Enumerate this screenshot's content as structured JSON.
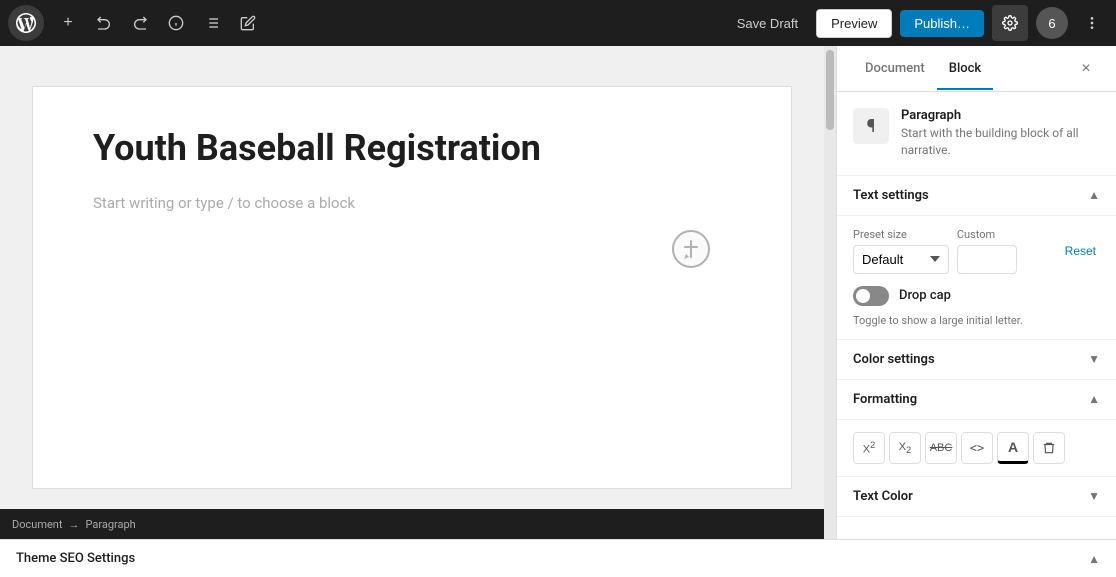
{
  "toolbar": {
    "logo_label": "WordPress",
    "add_btn": "+",
    "undo_btn": "↩",
    "redo_btn": "↪",
    "info_btn": "ℹ",
    "list_btn": "≡",
    "edit_btn": "✏",
    "save_draft_label": "Save Draft",
    "preview_label": "Preview",
    "publish_label": "Publish…",
    "settings_label": "⚙",
    "avatar_label": "6"
  },
  "editor": {
    "title": "Youth Baseball Registration",
    "placeholder": "Start writing or type / to choose a block",
    "footer": {
      "document_label": "Document",
      "arrow": "→",
      "paragraph_label": "Paragraph"
    }
  },
  "sidebar": {
    "tab_document": "Document",
    "tab_block": "Block",
    "close_icon": "×",
    "block_info": {
      "icon": "¶",
      "title": "Paragraph",
      "description": "Start with the building block of all narrative."
    },
    "text_settings": {
      "section_title": "Text settings",
      "preset_size_label": "Preset size",
      "custom_label": "Custom",
      "preset_options": [
        "Default"
      ],
      "preset_default": "Default",
      "reset_label": "Reset",
      "drop_cap_label": "Drop cap",
      "drop_cap_desc": "Toggle to show a large initial letter."
    },
    "color_settings": {
      "section_title": "Color settings"
    },
    "formatting": {
      "section_title": "Formatting",
      "buttons": [
        {
          "name": "superscript",
          "label": "X²",
          "symbol": "X²"
        },
        {
          "name": "subscript",
          "label": "X₂",
          "symbol": "X₂"
        },
        {
          "name": "strikethrough",
          "label": "ABC̶",
          "symbol": "A̶B̶C̶"
        },
        {
          "name": "code",
          "label": "<>",
          "symbol": "<>"
        },
        {
          "name": "highlight",
          "label": "A",
          "symbol": "A"
        },
        {
          "name": "clear",
          "label": "🗑",
          "symbol": "⌫"
        }
      ]
    },
    "text_color": {
      "section_title": "Text Color"
    }
  },
  "bottom_bar": {
    "theme_seo_label": "Theme SEO Settings",
    "chevron_up": "▲"
  }
}
